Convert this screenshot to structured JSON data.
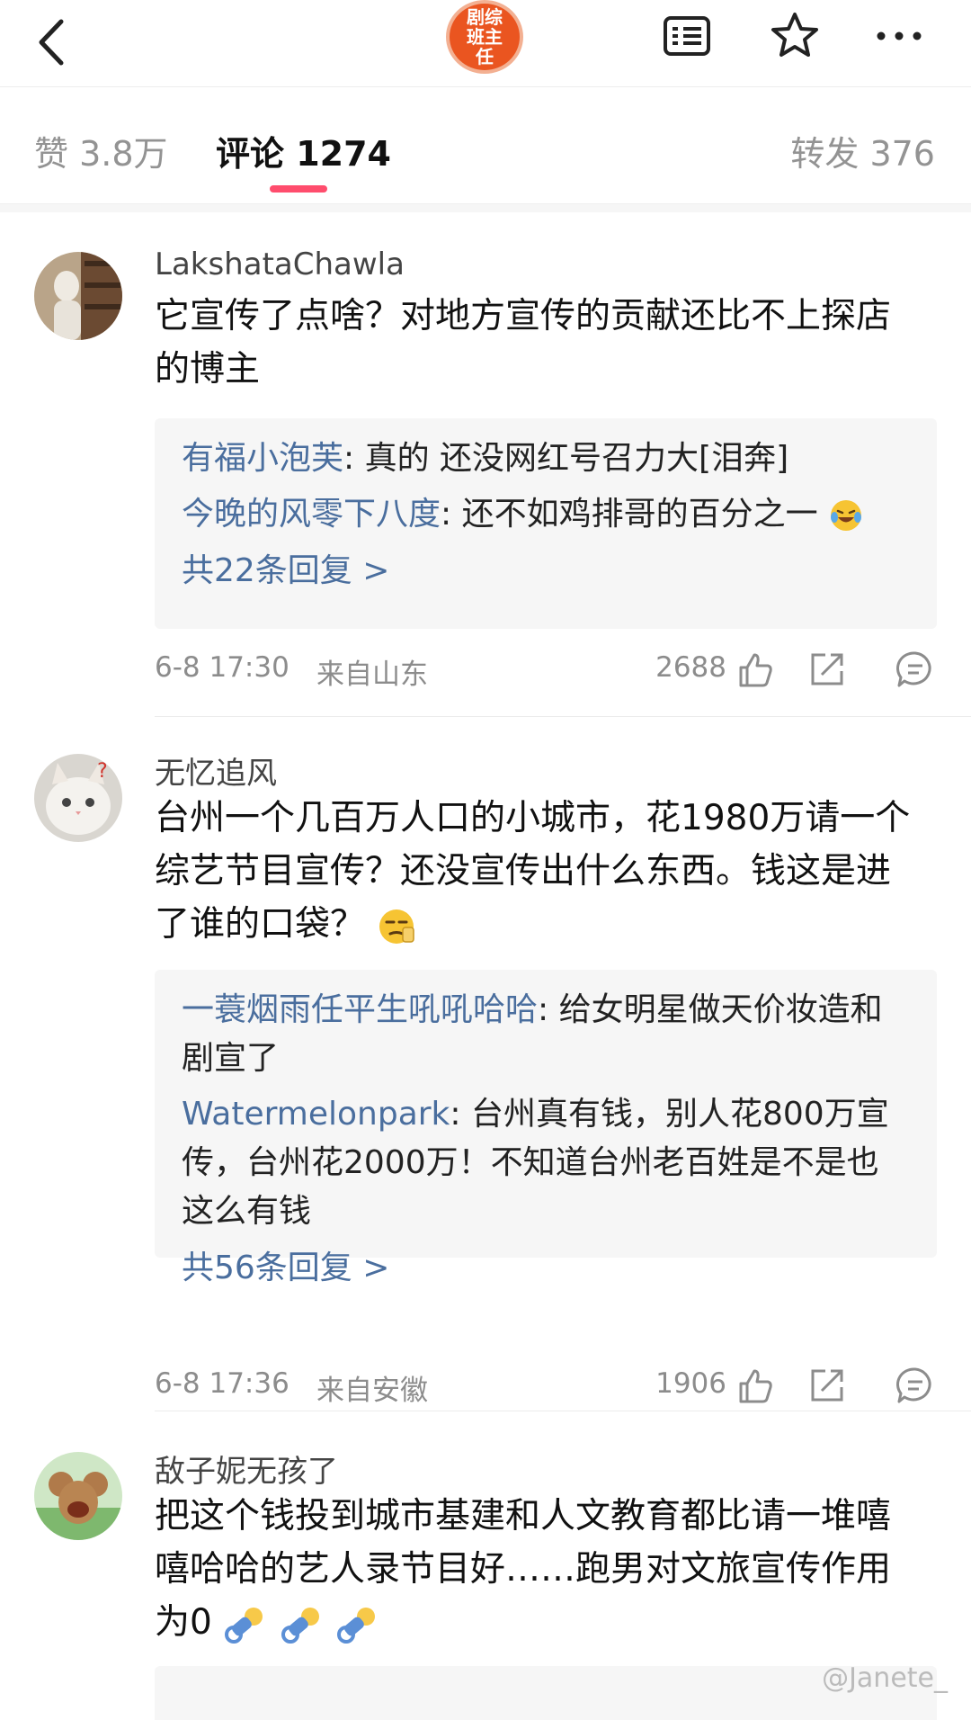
{
  "header": {
    "logo_text": "剧综班主任"
  },
  "tabs": {
    "likes": "赞 3.8万",
    "comments": "评论 1274",
    "reposts": "转发 376"
  },
  "comments": [
    {
      "user": "LakshataChawla",
      "text_line1": "它宣传了点啥？对地方宣传的贡献还比不上探店",
      "text_line2": "的博主",
      "replies": [
        {
          "name": "有福小泡芙",
          "text": ": 真的 还没网红号召力大[泪奔]"
        },
        {
          "name": "今晚的风零下八度",
          "text": ": 还不如鸡排哥的百分之一"
        }
      ],
      "reply_count": "共22条回复 >",
      "time": "6-8 17:30",
      "location": "来自山东",
      "likes": "2688"
    },
    {
      "user": "无忆追风",
      "text_line1": "台州一个几百万人口的小城市，花1980万请一个",
      "text_line2": "综艺节目宣传？还没宣传出什么东西。钱这是进",
      "text_line3": "了谁的口袋？",
      "replies": [
        {
          "name": "一蓑烟雨任平生吼吼哈哈",
          "text": ": 给女明星做天价妆造和剧宣了"
        },
        {
          "name": "Watermelonpark",
          "text": ": 台州真有钱，别人花800万宣传，台州花2000万！不知道台州老百姓是不是也这么有钱"
        }
      ],
      "reply_count": "共56条回复 >",
      "time": "6-8 17:36",
      "location": "来自安徽",
      "likes": "1906"
    },
    {
      "user": "敌子妮无孩了",
      "text_line1": "把这个钱投到城市基建和人文教育都比请一堆嘻",
      "text_line2": "嘻哈哈的艺人录节目好……跑男对文旅宣传作用",
      "text_line3": "为0"
    }
  ],
  "watermark": "@Janete_"
}
